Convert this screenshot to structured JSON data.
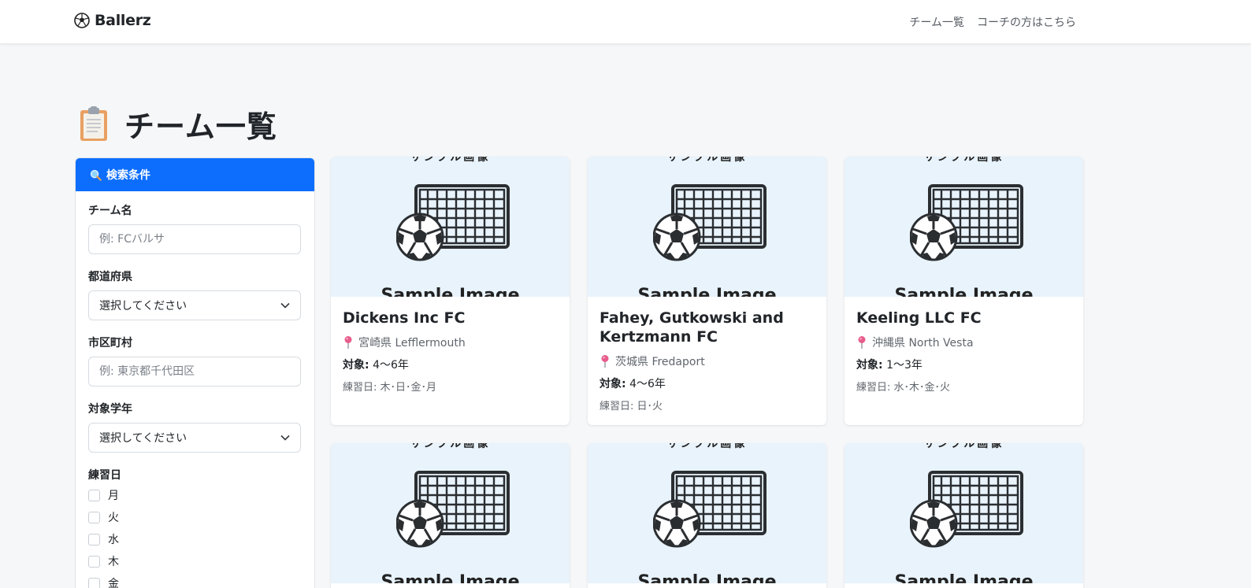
{
  "navbar": {
    "brand": "Ballerz",
    "brand_icon": "soccer-ball-icon",
    "links": [
      "チーム一覧",
      "コーチの方はこちら"
    ]
  },
  "page": {
    "title": "チーム一覧",
    "title_icon": "clipboard-icon"
  },
  "search": {
    "header": "検索条件",
    "header_icon": "magnifier-icon",
    "team_name_label": "チーム名",
    "team_name_placeholder": "例: FCバルサ",
    "prefecture_label": "都道府県",
    "prefecture_value": "選択してください",
    "city_label": "市区町村",
    "city_placeholder": "例: 東京都千代田区",
    "grade_label": "対象学年",
    "grade_value": "選択してください",
    "days_label": "練習日",
    "days": [
      "月",
      "火",
      "水",
      "木",
      "金"
    ]
  },
  "cards": [
    {
      "name": "Dickens Inc FC",
      "location": "宮崎県 Lefflermouth",
      "target_label": "対象:",
      "target": "4〜6年",
      "practice": "練習日: 木･日･金･月",
      "image_text": "Sample Image"
    },
    {
      "name": "Fahey, Gutkowski and Kertzmann FC",
      "location": "茨城県 Fredaport",
      "target_label": "対象:",
      "target": "4〜6年",
      "practice": "練習日: 日･火",
      "image_text": "Sample Image"
    },
    {
      "name": "Keeling LLC FC",
      "location": "沖縄県 North Vesta",
      "target_label": "対象:",
      "target": "1〜3年",
      "practice": "練習日: 水･木･金･火",
      "image_text": "Sample Image"
    },
    {
      "image_text": "Sample Image"
    },
    {
      "image_text": "Sample Image"
    },
    {
      "image_text": "Sample Image"
    }
  ],
  "colors": {
    "primary": "#0d6efd",
    "background": "#f6f7f9",
    "image_bg": "#e8f3fc",
    "pin": "#e85d8c"
  }
}
